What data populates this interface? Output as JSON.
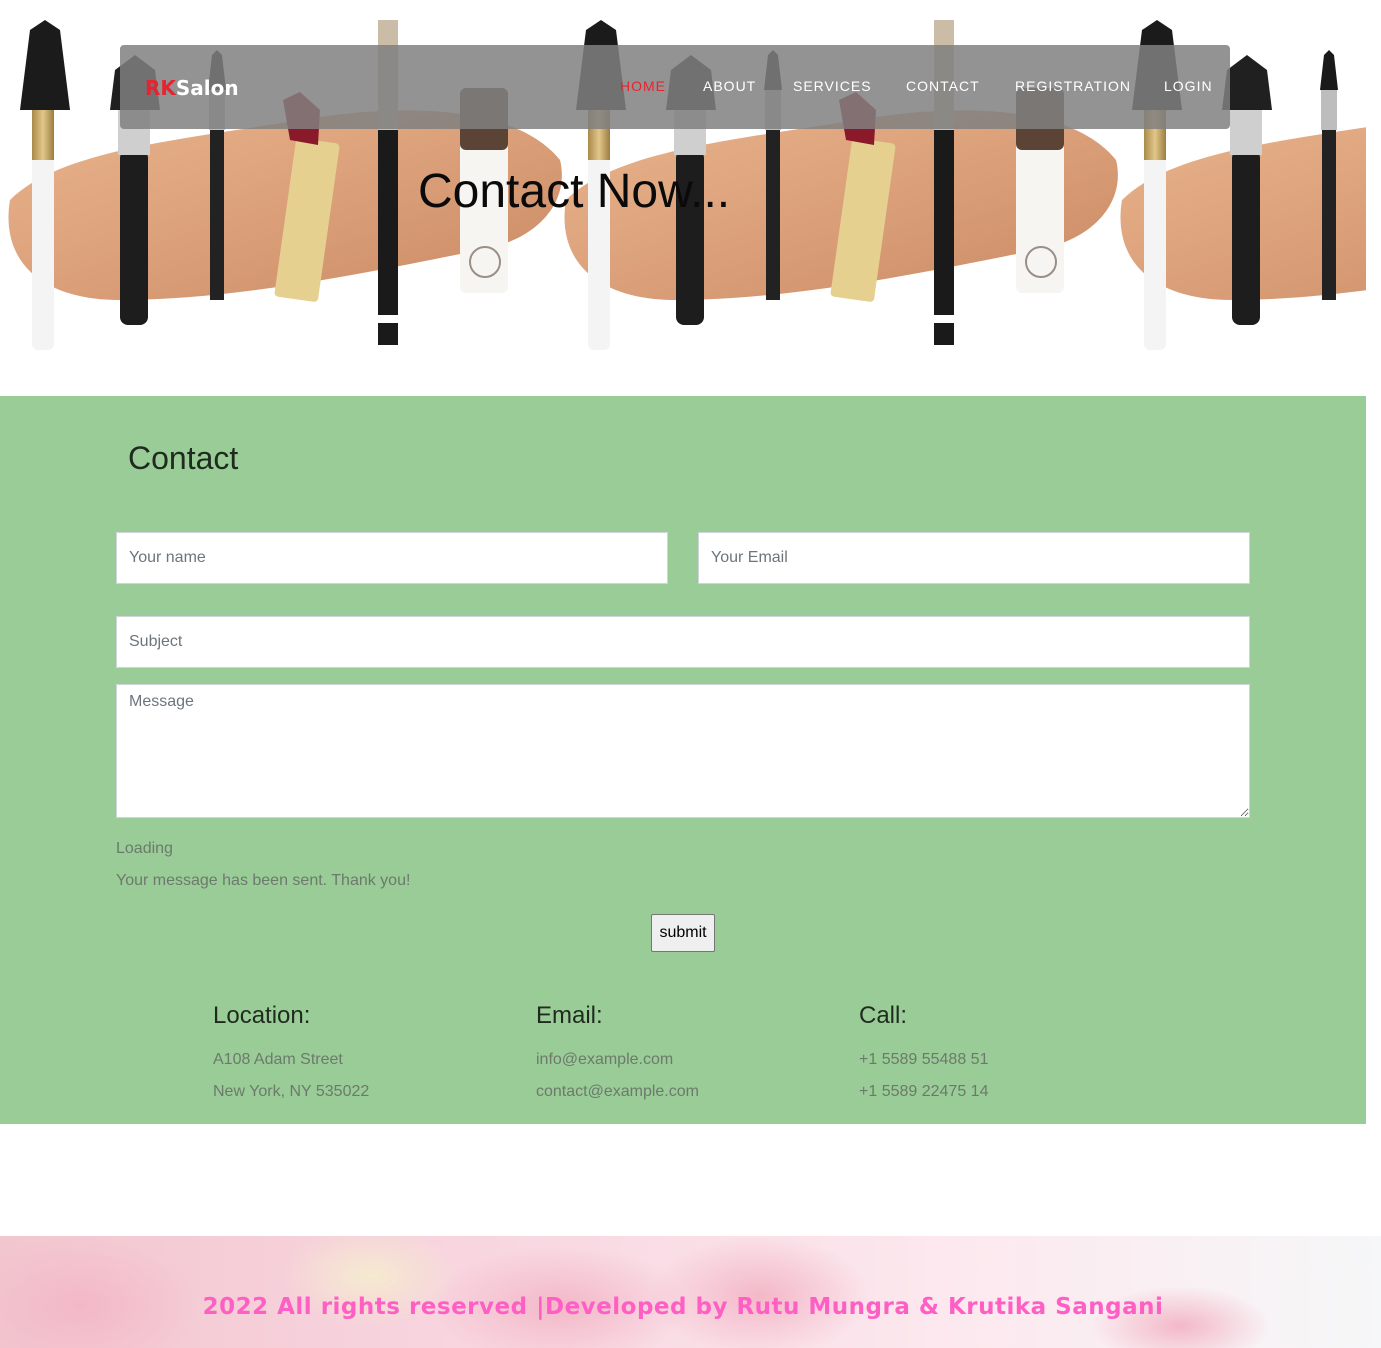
{
  "brand": {
    "prefix": "RK",
    "suffix": "Salon"
  },
  "nav": {
    "items": [
      "HOME",
      "ABOUT",
      "SERVICES",
      "CONTACT",
      "REGISTRATION",
      "LOGIN"
    ],
    "active": "HOME",
    "active_color": "#e8232f"
  },
  "hero": {
    "title": "Contact Now..."
  },
  "contact": {
    "heading": "Contact",
    "name_placeholder": "Your name",
    "email_placeholder": "Your Email",
    "subject_placeholder": "Subject",
    "message_placeholder": "Message",
    "loading_text": "Loading",
    "sent_text": "Your message has been sent. Thank you!",
    "submit_label": "submit",
    "background_color": "#9acc97"
  },
  "info": {
    "location": {
      "title": "Location:",
      "lines": [
        "A108 Adam Street",
        "New York, NY 535022"
      ]
    },
    "email": {
      "title": "Email:",
      "lines": [
        "info@example.com",
        "contact@example.com"
      ]
    },
    "call": {
      "title": "Call:",
      "lines": [
        "+1 5589 55488 51",
        "+1 5589 22475 14"
      ]
    }
  },
  "footer": {
    "text": "2022 All rights reserved |Developed by Rutu Mungra & Krutika Sangani",
    "text_color": "#ff5fc4"
  }
}
